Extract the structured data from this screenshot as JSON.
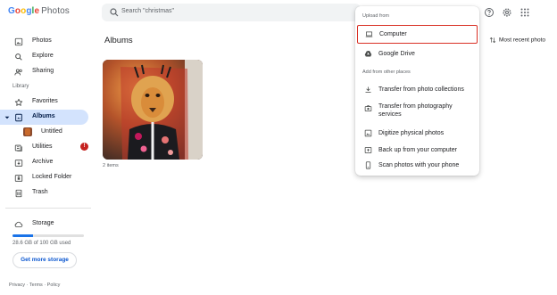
{
  "app": {
    "logo_word": "Google",
    "logo_product": "Photos"
  },
  "search": {
    "placeholder": "Search \"christmas\""
  },
  "sidebar": {
    "items": [
      {
        "label": "Photos",
        "icon": "image-icon"
      },
      {
        "label": "Explore",
        "icon": "search-icon"
      },
      {
        "label": "Sharing",
        "icon": "people-icon"
      }
    ],
    "library_label": "Library",
    "library_items": [
      {
        "label": "Favorites",
        "icon": "star-icon"
      },
      {
        "label": "Albums",
        "icon": "album-icon",
        "active": true
      },
      {
        "label": "Untitled",
        "icon": "album-thumbnail"
      },
      {
        "label": "Utilities",
        "icon": "utilities-icon",
        "badge": "!"
      },
      {
        "label": "Archive",
        "icon": "archive-icon"
      },
      {
        "label": "Locked Folder",
        "icon": "lock-icon"
      },
      {
        "label": "Trash",
        "icon": "trash-icon"
      }
    ],
    "storage_label": "Storage",
    "storage_used": "28.6 GB of 100 GB used",
    "storage_fraction": 0.286,
    "get_more_storage": "Get more storage",
    "footer": "Privacy · Terms · Policy"
  },
  "main": {
    "title": "Albums",
    "sort_label": "Most recent photo",
    "album_count": "2 items"
  },
  "upload_menu": {
    "upload_from_label": "Upload from",
    "upload_items": [
      {
        "label": "Computer",
        "icon": "laptop-icon",
        "highlight": true
      },
      {
        "label": "Google Drive",
        "icon": "drive-icon"
      }
    ],
    "other_places_label": "Add from other places",
    "other_items": [
      {
        "label": "Transfer from photo collections",
        "icon": "download-icon"
      },
      {
        "label": "Transfer from photography services",
        "icon": "camera-icon"
      },
      {
        "label": "Digitize physical photos",
        "icon": "photo-scan-icon"
      },
      {
        "label": "Back up from your computer",
        "icon": "backup-icon"
      },
      {
        "label": "Scan photos with your phone",
        "icon": "phone-icon"
      }
    ]
  },
  "colors": {
    "accent": "#1a73e8",
    "active_bg": "#d3e3fd",
    "highlight_border": "#d93025",
    "badge": "#c5221f"
  }
}
